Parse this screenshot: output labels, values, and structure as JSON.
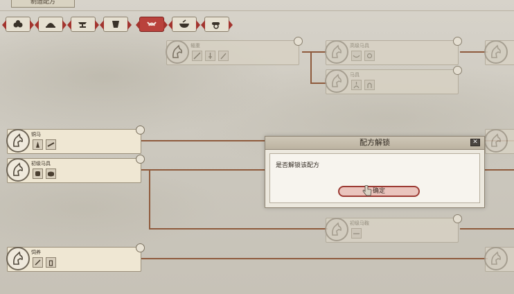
{
  "header": {
    "title": "制造配方"
  },
  "tabs": [
    {
      "icon": "cluster-icon",
      "active": false
    },
    {
      "icon": "helmet-icon",
      "active": false
    },
    {
      "icon": "anvil-icon",
      "active": false
    },
    {
      "icon": "armor-icon",
      "active": false
    },
    {
      "icon": "saddle-icon",
      "active": true
    },
    {
      "icon": "bowl-icon",
      "active": false
    },
    {
      "icon": "cannon-icon",
      "active": false
    }
  ],
  "nodes": [
    {
      "id": "n-top-1",
      "title": "辎重",
      "dim": true
    },
    {
      "id": "n-top-2",
      "title": "高级马具",
      "dim": true
    },
    {
      "id": "n-top-3",
      "title": "",
      "dim": true
    },
    {
      "id": "n-top-4",
      "title": "马具",
      "dim": true
    },
    {
      "id": "n-left-1",
      "title": "铜马",
      "dim": false
    },
    {
      "id": "n-left-2",
      "title": "初级马具",
      "dim": false
    },
    {
      "id": "n-left-3",
      "title": "饲养",
      "dim": false
    },
    {
      "id": "n-mid",
      "title": "初级马鞍",
      "dim": true
    },
    {
      "id": "n-right-1",
      "title": "",
      "dim": true
    },
    {
      "id": "n-right-2",
      "title": "",
      "dim": true
    }
  ],
  "dialog": {
    "title": "配方解锁",
    "close": "✕",
    "message": "是否解锁该配方",
    "confirm": "确定"
  },
  "colors": {
    "accent": "#b9423c",
    "connector": "#8e5a3c",
    "panel": "#efe7d3"
  }
}
